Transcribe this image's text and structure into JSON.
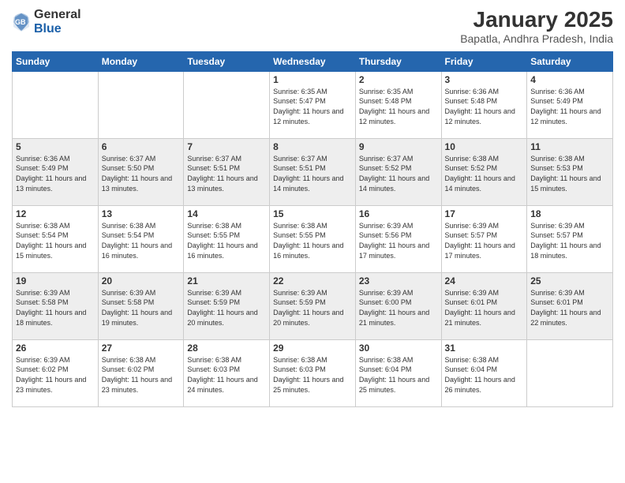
{
  "header": {
    "logo_general": "General",
    "logo_blue": "Blue",
    "month_year": "January 2025",
    "location": "Bapatla, Andhra Pradesh, India"
  },
  "weekdays": [
    "Sunday",
    "Monday",
    "Tuesday",
    "Wednesday",
    "Thursday",
    "Friday",
    "Saturday"
  ],
  "weeks": [
    [
      {
        "day": "",
        "sunrise": "",
        "sunset": "",
        "daylight": ""
      },
      {
        "day": "",
        "sunrise": "",
        "sunset": "",
        "daylight": ""
      },
      {
        "day": "",
        "sunrise": "",
        "sunset": "",
        "daylight": ""
      },
      {
        "day": "1",
        "sunrise": "Sunrise: 6:35 AM",
        "sunset": "Sunset: 5:47 PM",
        "daylight": "Daylight: 11 hours and 12 minutes."
      },
      {
        "day": "2",
        "sunrise": "Sunrise: 6:35 AM",
        "sunset": "Sunset: 5:48 PM",
        "daylight": "Daylight: 11 hours and 12 minutes."
      },
      {
        "day": "3",
        "sunrise": "Sunrise: 6:36 AM",
        "sunset": "Sunset: 5:48 PM",
        "daylight": "Daylight: 11 hours and 12 minutes."
      },
      {
        "day": "4",
        "sunrise": "Sunrise: 6:36 AM",
        "sunset": "Sunset: 5:49 PM",
        "daylight": "Daylight: 11 hours and 12 minutes."
      }
    ],
    [
      {
        "day": "5",
        "sunrise": "Sunrise: 6:36 AM",
        "sunset": "Sunset: 5:49 PM",
        "daylight": "Daylight: 11 hours and 13 minutes."
      },
      {
        "day": "6",
        "sunrise": "Sunrise: 6:37 AM",
        "sunset": "Sunset: 5:50 PM",
        "daylight": "Daylight: 11 hours and 13 minutes."
      },
      {
        "day": "7",
        "sunrise": "Sunrise: 6:37 AM",
        "sunset": "Sunset: 5:51 PM",
        "daylight": "Daylight: 11 hours and 13 minutes."
      },
      {
        "day": "8",
        "sunrise": "Sunrise: 6:37 AM",
        "sunset": "Sunset: 5:51 PM",
        "daylight": "Daylight: 11 hours and 14 minutes."
      },
      {
        "day": "9",
        "sunrise": "Sunrise: 6:37 AM",
        "sunset": "Sunset: 5:52 PM",
        "daylight": "Daylight: 11 hours and 14 minutes."
      },
      {
        "day": "10",
        "sunrise": "Sunrise: 6:38 AM",
        "sunset": "Sunset: 5:52 PM",
        "daylight": "Daylight: 11 hours and 14 minutes."
      },
      {
        "day": "11",
        "sunrise": "Sunrise: 6:38 AM",
        "sunset": "Sunset: 5:53 PM",
        "daylight": "Daylight: 11 hours and 15 minutes."
      }
    ],
    [
      {
        "day": "12",
        "sunrise": "Sunrise: 6:38 AM",
        "sunset": "Sunset: 5:54 PM",
        "daylight": "Daylight: 11 hours and 15 minutes."
      },
      {
        "day": "13",
        "sunrise": "Sunrise: 6:38 AM",
        "sunset": "Sunset: 5:54 PM",
        "daylight": "Daylight: 11 hours and 16 minutes."
      },
      {
        "day": "14",
        "sunrise": "Sunrise: 6:38 AM",
        "sunset": "Sunset: 5:55 PM",
        "daylight": "Daylight: 11 hours and 16 minutes."
      },
      {
        "day": "15",
        "sunrise": "Sunrise: 6:38 AM",
        "sunset": "Sunset: 5:55 PM",
        "daylight": "Daylight: 11 hours and 16 minutes."
      },
      {
        "day": "16",
        "sunrise": "Sunrise: 6:39 AM",
        "sunset": "Sunset: 5:56 PM",
        "daylight": "Daylight: 11 hours and 17 minutes."
      },
      {
        "day": "17",
        "sunrise": "Sunrise: 6:39 AM",
        "sunset": "Sunset: 5:57 PM",
        "daylight": "Daylight: 11 hours and 17 minutes."
      },
      {
        "day": "18",
        "sunrise": "Sunrise: 6:39 AM",
        "sunset": "Sunset: 5:57 PM",
        "daylight": "Daylight: 11 hours and 18 minutes."
      }
    ],
    [
      {
        "day": "19",
        "sunrise": "Sunrise: 6:39 AM",
        "sunset": "Sunset: 5:58 PM",
        "daylight": "Daylight: 11 hours and 18 minutes."
      },
      {
        "day": "20",
        "sunrise": "Sunrise: 6:39 AM",
        "sunset": "Sunset: 5:58 PM",
        "daylight": "Daylight: 11 hours and 19 minutes."
      },
      {
        "day": "21",
        "sunrise": "Sunrise: 6:39 AM",
        "sunset": "Sunset: 5:59 PM",
        "daylight": "Daylight: 11 hours and 20 minutes."
      },
      {
        "day": "22",
        "sunrise": "Sunrise: 6:39 AM",
        "sunset": "Sunset: 5:59 PM",
        "daylight": "Daylight: 11 hours and 20 minutes."
      },
      {
        "day": "23",
        "sunrise": "Sunrise: 6:39 AM",
        "sunset": "Sunset: 6:00 PM",
        "daylight": "Daylight: 11 hours and 21 minutes."
      },
      {
        "day": "24",
        "sunrise": "Sunrise: 6:39 AM",
        "sunset": "Sunset: 6:01 PM",
        "daylight": "Daylight: 11 hours and 21 minutes."
      },
      {
        "day": "25",
        "sunrise": "Sunrise: 6:39 AM",
        "sunset": "Sunset: 6:01 PM",
        "daylight": "Daylight: 11 hours and 22 minutes."
      }
    ],
    [
      {
        "day": "26",
        "sunrise": "Sunrise: 6:39 AM",
        "sunset": "Sunset: 6:02 PM",
        "daylight": "Daylight: 11 hours and 23 minutes."
      },
      {
        "day": "27",
        "sunrise": "Sunrise: 6:38 AM",
        "sunset": "Sunset: 6:02 PM",
        "daylight": "Daylight: 11 hours and 23 minutes."
      },
      {
        "day": "28",
        "sunrise": "Sunrise: 6:38 AM",
        "sunset": "Sunset: 6:03 PM",
        "daylight": "Daylight: 11 hours and 24 minutes."
      },
      {
        "day": "29",
        "sunrise": "Sunrise: 6:38 AM",
        "sunset": "Sunset: 6:03 PM",
        "daylight": "Daylight: 11 hours and 25 minutes."
      },
      {
        "day": "30",
        "sunrise": "Sunrise: 6:38 AM",
        "sunset": "Sunset: 6:04 PM",
        "daylight": "Daylight: 11 hours and 25 minutes."
      },
      {
        "day": "31",
        "sunrise": "Sunrise: 6:38 AM",
        "sunset": "Sunset: 6:04 PM",
        "daylight": "Daylight: 11 hours and 26 minutes."
      },
      {
        "day": "",
        "sunrise": "",
        "sunset": "",
        "daylight": ""
      }
    ]
  ]
}
